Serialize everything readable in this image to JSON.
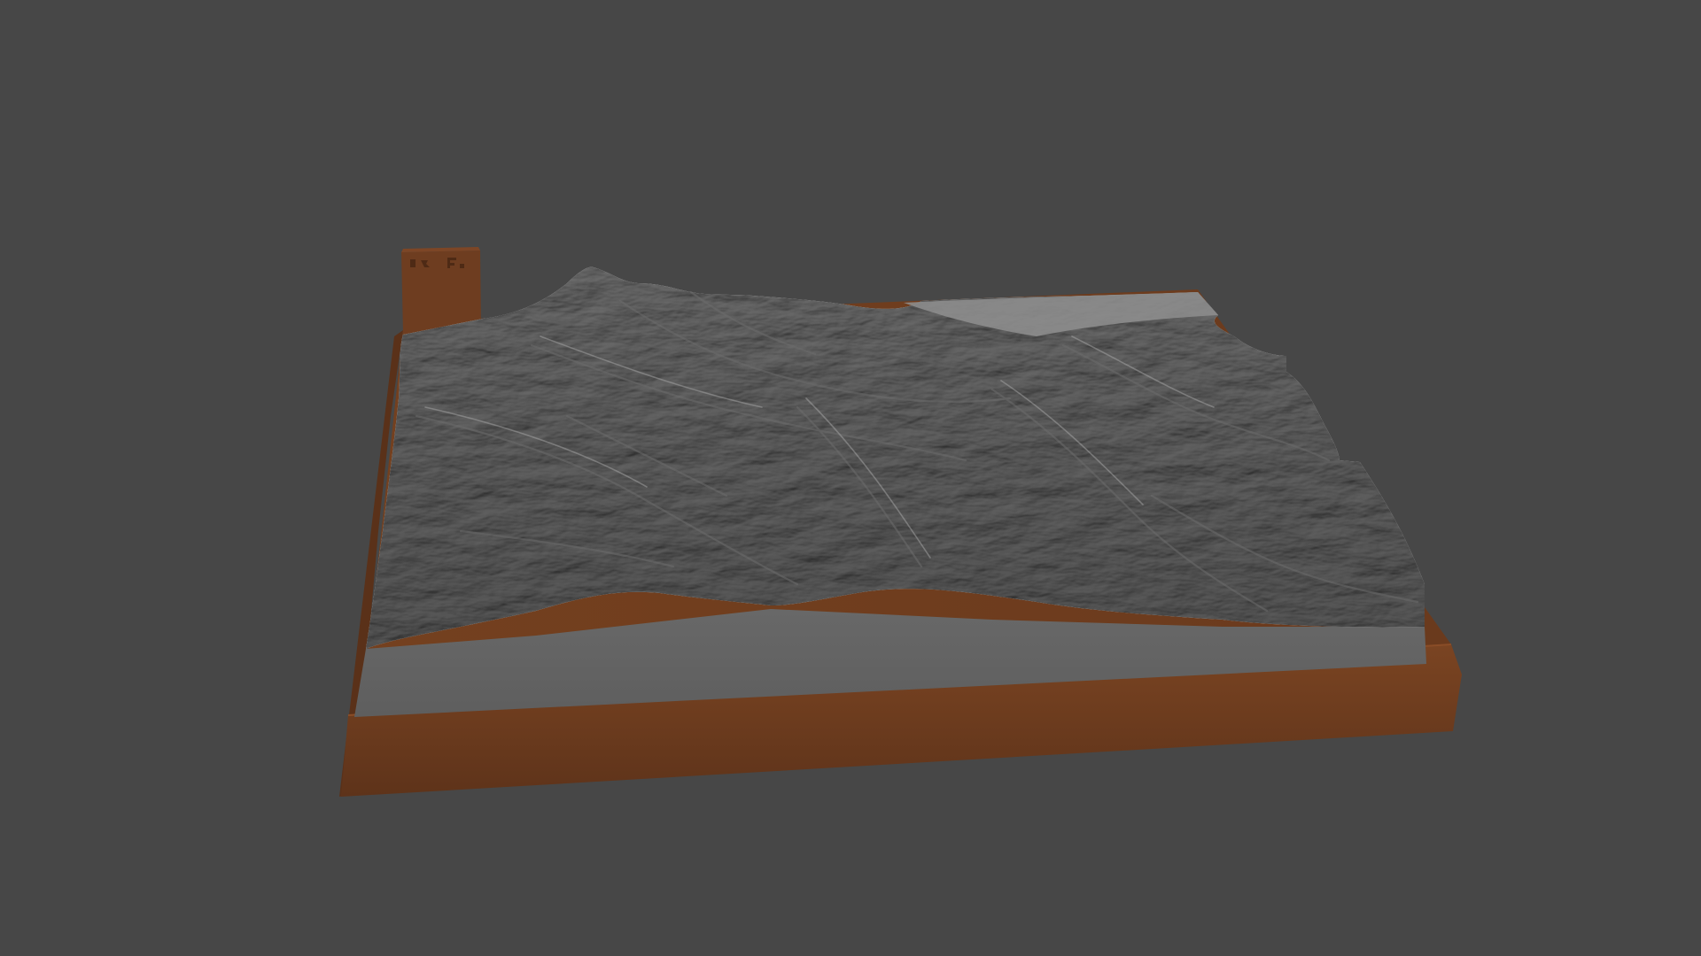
{
  "viewport": {
    "background_color": "#474747",
    "object": {
      "type": "terrain relief model on base",
      "base_color": "#6b3b1f",
      "terrain_color": "#8e8e8e",
      "side_color": "#646464",
      "label_block_text": "",
      "label_block_color": "#6e3d20"
    }
  }
}
